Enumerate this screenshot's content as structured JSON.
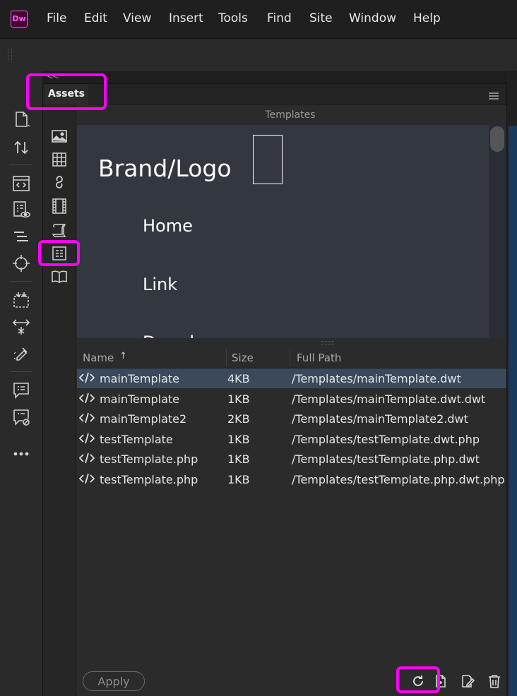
{
  "app": {
    "logo_text": "Dw"
  },
  "menu": [
    "File",
    "Edit",
    "View",
    "Insert",
    "Tools",
    "Find",
    "Site",
    "Window",
    "Help"
  ],
  "panel": {
    "tab_label": "Assets",
    "preview_title": "Templates",
    "preview": {
      "brand": "Brand/Logo",
      "nav_items": [
        "Home",
        "Link",
        "Dropdown"
      ]
    },
    "columns": {
      "name": "Name",
      "size": "Size",
      "path": "Full Path"
    },
    "sort_indicator": "↑",
    "rows": [
      {
        "name": "mainTemplate",
        "size": "4KB",
        "path": "/Templates/mainTemplate.dwt",
        "selected": true
      },
      {
        "name": "mainTemplate",
        "size": "1KB",
        "path": "/Templates/mainTemplate.dwt.dwt",
        "selected": false
      },
      {
        "name": "mainTemplate2",
        "size": "2KB",
        "path": "/Templates/mainTemplate2.dwt",
        "selected": false
      },
      {
        "name": "testTemplate",
        "size": "1KB",
        "path": "/Templates/testTemplate.dwt.php",
        "selected": false
      },
      {
        "name": "testTemplate.php",
        "size": "1KB",
        "path": "/Templates/testTemplate.php.dwt",
        "selected": false
      },
      {
        "name": "testTemplate.php",
        "size": "1KB",
        "path": "/Templates/testTemplate.php.dwt.php",
        "selected": false
      }
    ],
    "apply_label": "Apply"
  },
  "colors": {
    "highlight": "#ff00ff",
    "selected_row": "#3a4a5c",
    "preview_bg": "#333740",
    "panel_bg": "#2b2b2b"
  },
  "icons": {
    "left_toolbar": [
      "new-document-icon",
      "file-transfer-icon",
      "code-view-icon",
      "live-view-icon",
      "dom-panel-icon",
      "target-icon",
      "select-region-icon",
      "resize-icon",
      "edit-more-icon",
      "comment-icon",
      "comment-disabled-icon",
      "more-icon"
    ],
    "categories": [
      "images-icon",
      "colors-icon",
      "urls-icon",
      "media-icon",
      "scripts-icon",
      "templates-icon",
      "library-icon"
    ],
    "bottom": [
      "refresh-icon",
      "new-template-icon",
      "edit-icon",
      "trash-icon"
    ]
  }
}
